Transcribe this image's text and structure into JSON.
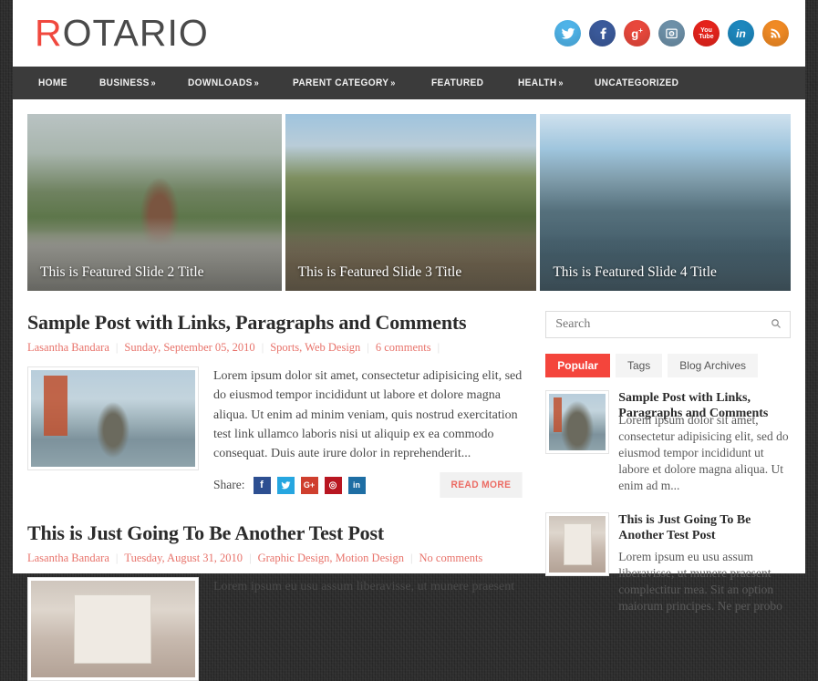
{
  "site": {
    "logo_accent": "R",
    "logo_rest": "OTARIO",
    "accent_color": "#f0483e"
  },
  "social": [
    {
      "name": "twitter-icon",
      "label": "Twitter",
      "color": "#4fb3e8"
    },
    {
      "name": "facebook-icon",
      "label": "Facebook",
      "color": "#3b5a9b"
    },
    {
      "name": "googleplus-icon",
      "label": "Google Plus",
      "color": "#e8483c"
    },
    {
      "name": "instagram-icon",
      "label": "Instagram",
      "color": "#6d90a8"
    },
    {
      "name": "youtube-icon",
      "label": "YouTube",
      "color": "#e5241c"
    },
    {
      "name": "linkedin-icon",
      "label": "LinkedIn",
      "color": "#1d87bd"
    },
    {
      "name": "rss-icon",
      "label": "RSS",
      "color": "#f08a24"
    }
  ],
  "nav": {
    "items": [
      {
        "label": "HOME",
        "caret": ""
      },
      {
        "label": "BUSINESS",
        "caret": "»"
      },
      {
        "label": "DOWNLOADS",
        "caret": "»"
      },
      {
        "label": "PARENT CATEGORY",
        "caret": "»"
      },
      {
        "label": "FEATURED",
        "caret": ""
      },
      {
        "label": "HEALTH",
        "caret": "»"
      },
      {
        "label": "UNCATEGORIZED",
        "caret": ""
      }
    ]
  },
  "slider": {
    "slides": [
      {
        "caption": "This is Featured Slide 2 Title"
      },
      {
        "caption": "This is Featured Slide 3 Title"
      },
      {
        "caption": "This is Featured Slide 4 Title"
      }
    ]
  },
  "posts": [
    {
      "title": "Sample Post with Links, Paragraphs and Comments",
      "author": "Lasantha Bandara",
      "date": "Sunday, September 05, 2010",
      "categories": "Sports, Web Design",
      "comments": "6 comments",
      "excerpt": "Lorem ipsum dolor sit amet, consectetur adipisicing elit, sed do eiusmod tempor incididunt ut labore et dolore magna aliqua. Ut enim ad minim veniam, quis nostrud exercitation test link ullamco laboris nisi ut aliquip ex ea commodo consequat. Duis aute irure dolor in reprehenderit...",
      "share_label": "Share:",
      "read_more": "Read More"
    },
    {
      "title": "This is Just Going To Be Another Test Post",
      "author": "Lasantha Bandara",
      "date": "Tuesday, August 31, 2010",
      "categories": "Graphic Design, Motion Design",
      "comments": "No comments",
      "excerpt": "Lorem ipsum eu usu assum liberavisse, ut munere praesent"
    }
  ],
  "share_buttons": [
    {
      "name": "facebook-share-icon",
      "glyph": "f"
    },
    {
      "name": "twitter-share-icon",
      "glyph": "t"
    },
    {
      "name": "googleplus-share-icon",
      "glyph": "G+"
    },
    {
      "name": "pinterest-share-icon",
      "glyph": "P"
    },
    {
      "name": "linkedin-share-icon",
      "glyph": "in"
    }
  ],
  "sidebar": {
    "search": {
      "placeholder": "Search",
      "value": "",
      "icon": "search-icon"
    },
    "tabs": [
      {
        "label": "Popular",
        "active": true
      },
      {
        "label": "Tags",
        "active": false
      },
      {
        "label": "Blog Archives",
        "active": false
      }
    ],
    "popular": [
      {
        "title": "Sample Post with Links, Paragraphs and Comments",
        "excerpt": "Lorem ipsum dolor sit amet, consectetur adipisicing elit, sed do eiusmod tempor incididunt ut labore et dolore magna aliqua. Ut enim ad m..."
      },
      {
        "title": "This is Just Going To Be Another Test Post",
        "excerpt": "Lorem ipsum eu usu assum liberavisse, ut munere praesent complectitur mea. Sit an option maiorum principes. Ne per probo"
      }
    ]
  }
}
